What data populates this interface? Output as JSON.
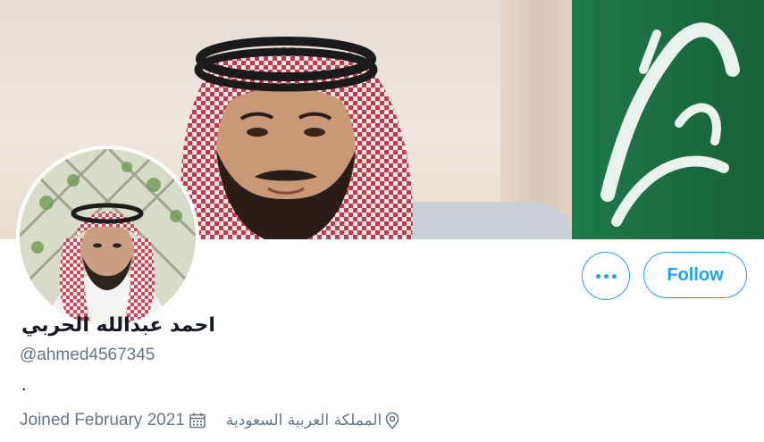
{
  "profile": {
    "display_name": "احمد عبدالله الحربي",
    "handle": "@ahmed4567345",
    "bio": ".",
    "joined": "Joined February 2021",
    "location": "المملكة العربية السعودية"
  },
  "actions": {
    "follow_label": "Follow"
  },
  "icons": {
    "more": "more-options-icon",
    "calendar": "calendar-icon",
    "location": "location-pin-icon"
  },
  "colors": {
    "accent": "#1da1f2",
    "primary_text": "#141823",
    "secondary_text": "#657786",
    "flag_green": "#1c6e43"
  }
}
